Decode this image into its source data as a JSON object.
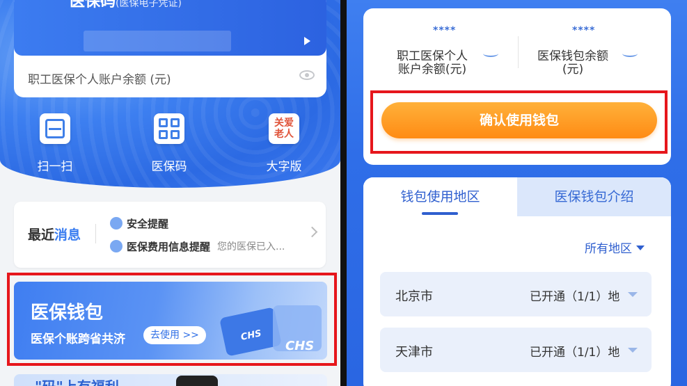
{
  "left": {
    "card": {
      "title": "医保码",
      "title_note": "(医保电子凭证)",
      "balance_label": "职工医保个人账户余额 (元)"
    },
    "quick_actions": [
      {
        "label": "扫一扫",
        "icon": "scan-icon"
      },
      {
        "label": "医保码",
        "icon": "qr-code-icon"
      },
      {
        "label": "大字版",
        "icon": "elder-care-icon",
        "icon_text": "关爱老人"
      }
    ],
    "messages": {
      "title_prefix": "最近",
      "title_highlight": "消息",
      "items": [
        {
          "title": "安全提醒",
          "subtitle": ""
        },
        {
          "title": "医保费用信息提醒",
          "subtitle": "您的医保已入..."
        }
      ]
    },
    "wallet_banner": {
      "title": "医保钱包",
      "subtitle": "医保个账跨省共济",
      "button": "去使用 >>",
      "logo_text": "CHS"
    },
    "bottom_banner": {
      "text": "\"码\"上有福利"
    }
  },
  "right": {
    "balances": [
      {
        "masked": "****",
        "label_line1": "职工医保个人",
        "label_line2": "账户余额(元)"
      },
      {
        "masked": "****",
        "label_line1": "医保钱包余额",
        "label_line2": "(元)"
      }
    ],
    "confirm_button": "确认使用钱包",
    "tabs": [
      {
        "label": "钱包使用地区",
        "active": true
      },
      {
        "label": "医保钱包介绍",
        "active": false
      }
    ],
    "region_filter": "所有地区",
    "regions": [
      {
        "city": "北京市",
        "status": "已开通（1/1）地"
      },
      {
        "city": "天津市",
        "status": "已开通（1/1）地"
      }
    ]
  },
  "colors": {
    "primary_blue": "#3a7df0",
    "highlight_red": "#e6161c",
    "orange_button": "#ff9a22"
  }
}
